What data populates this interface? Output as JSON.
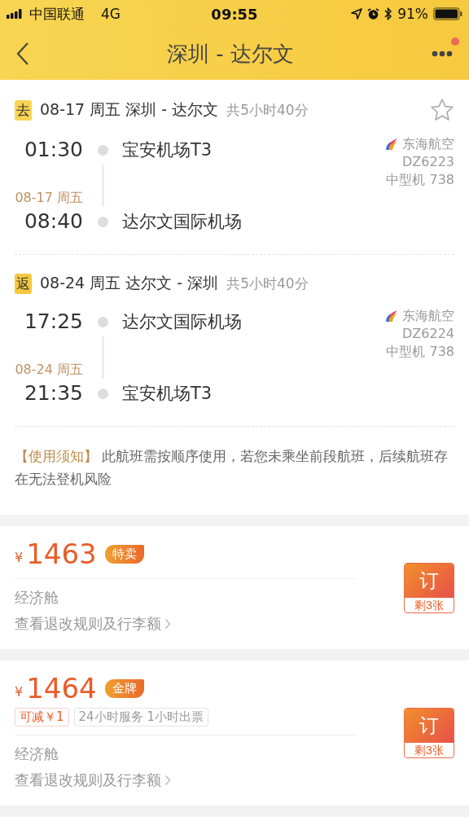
{
  "status_bar": {
    "carrier": "中国联通",
    "network": "4G",
    "time": "09:55",
    "battery": "91%"
  },
  "nav": {
    "title": "深圳 - 达尔文",
    "has_notification": true
  },
  "legs": [
    {
      "kind": "depart",
      "badge": "去",
      "date": "08-17 周五",
      "route": "深圳 - 达尔文",
      "duration": "共5小时40分",
      "favorited": false,
      "dep_time": "01:30",
      "dep_airport": "宝安机场T3",
      "arr_date": "08-17 周五",
      "arr_time": "08:40",
      "arr_airport": "达尔文国际机场",
      "airline": "东海航空",
      "flight_no": "DZ6223",
      "aircraft": "中型机 738"
    },
    {
      "kind": "return",
      "badge": "返",
      "date": "08-24 周五",
      "route": "达尔文 - 深圳",
      "duration": "共5小时40分",
      "dep_time": "17:25",
      "dep_airport": "达尔文国际机场",
      "arr_date": "08-24 周五",
      "arr_time": "21:35",
      "arr_airport": "宝安机场T3",
      "airline": "东海航空",
      "flight_no": "DZ6224",
      "aircraft": "中型机 738"
    }
  ],
  "notice": {
    "label": "【使用须知】",
    "text": "此航班需按顺序使用，若您未乘坐前段航班，后续航班存在无法登机风险"
  },
  "fares": [
    {
      "currency": "¥",
      "price": "1463",
      "tag": "特卖",
      "cabin": "经济舱",
      "rules_link": "查看退改规则及行李额",
      "book": "订",
      "remaining": "剩3张"
    },
    {
      "currency": "¥",
      "price": "1464",
      "tag": "金牌",
      "perks": [
        {
          "kind": "discount",
          "text": "可减￥1"
        },
        {
          "kind": "service",
          "text": "24小时服务 1小时出票"
        }
      ],
      "cabin": "经济舱",
      "rules_link": "查看退改规则及行李额",
      "book": "订",
      "remaining": "剩3张"
    }
  ]
}
